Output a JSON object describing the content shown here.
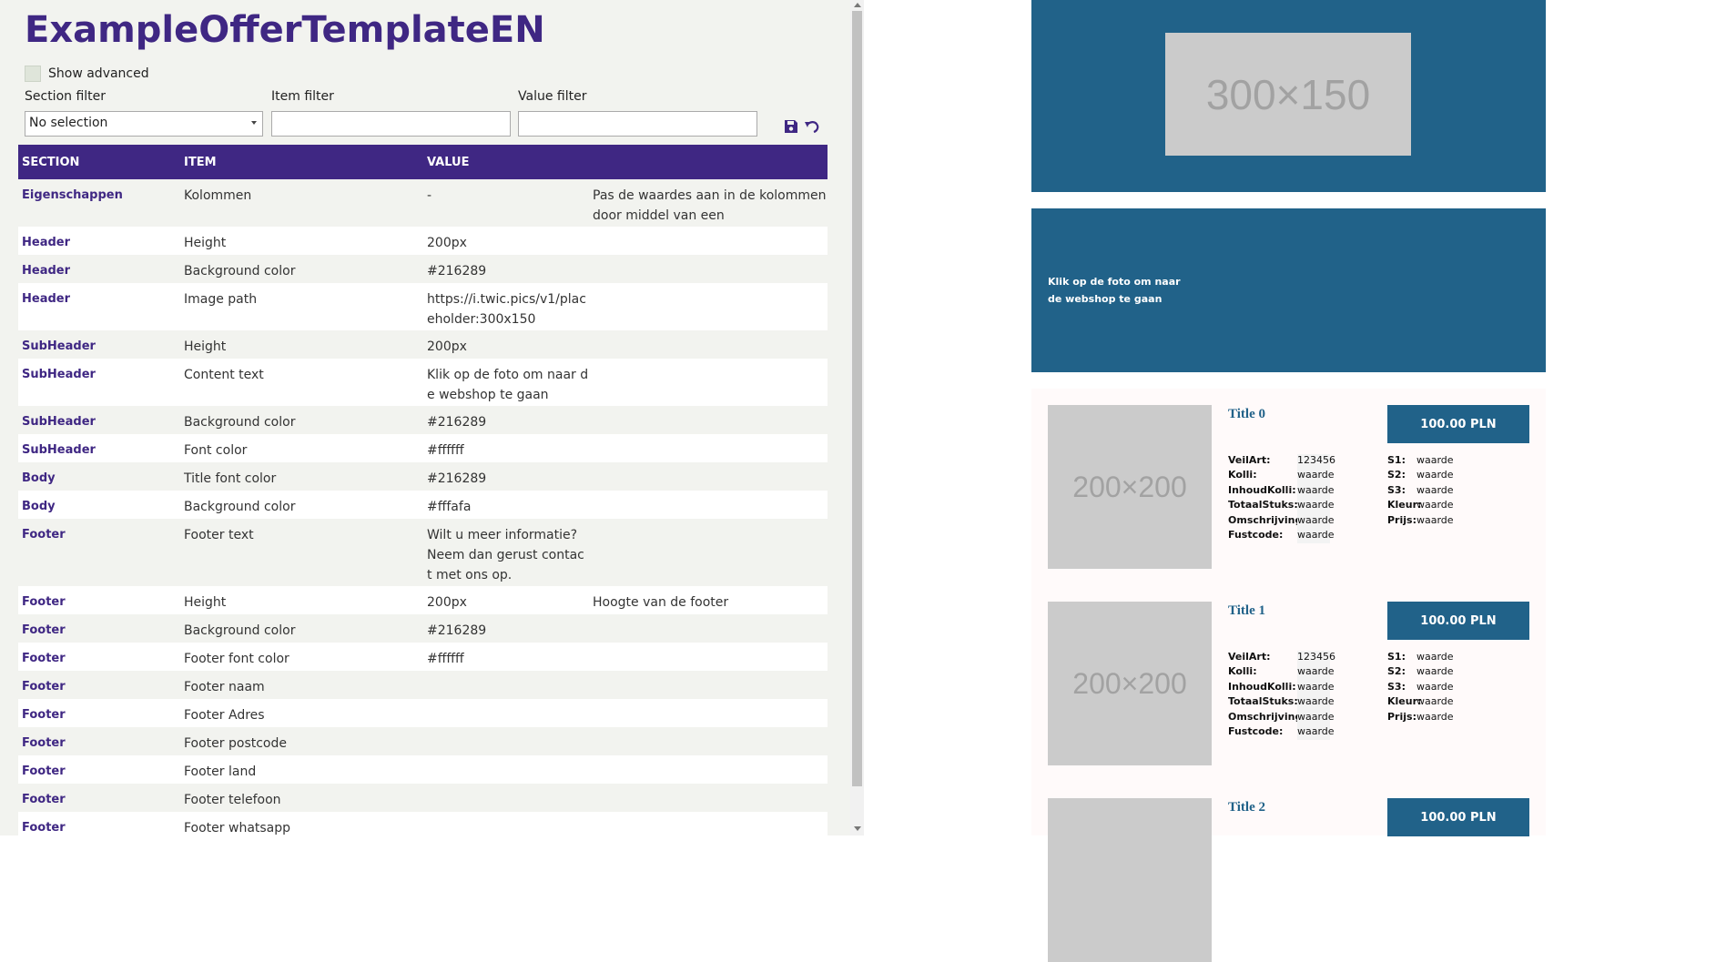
{
  "page": {
    "title": "ExampleOfferTemplateEN",
    "show_advanced_label": "Show advanced"
  },
  "filters": {
    "section_label": "Section filter",
    "section_value": "No selection",
    "item_label": "Item filter",
    "item_value": "",
    "value_label": "Value filter",
    "value_value": ""
  },
  "toolbar": {
    "save_icon": "save-icon",
    "undo_icon": "undo-icon"
  },
  "table": {
    "headers": [
      "SECTION",
      "ITEM",
      "VALUE",
      ""
    ],
    "rows": [
      {
        "section": "Eigenschappen",
        "item": "Kolommen",
        "value": "-",
        "desc": "Pas de waardes aan in de kolommen door middel van een webshopsetting"
      },
      {
        "section": "Header",
        "item": "Height",
        "value": "200px",
        "desc": ""
      },
      {
        "section": "Header",
        "item": "Background color",
        "value": "#216289",
        "desc": ""
      },
      {
        "section": "Header",
        "item": "Image path",
        "value": "https://i.twic.pics/v1/placeholder:300x150",
        "desc": ""
      },
      {
        "section": "SubHeader",
        "item": "Height",
        "value": "200px",
        "desc": ""
      },
      {
        "section": "SubHeader",
        "item": "Content text",
        "value": "Klik op de foto om naar de webshop te gaan",
        "desc": ""
      },
      {
        "section": "SubHeader",
        "item": "Background color",
        "value": "#216289",
        "desc": ""
      },
      {
        "section": "SubHeader",
        "item": "Font color",
        "value": "#ffffff",
        "desc": ""
      },
      {
        "section": "Body",
        "item": "Title font color",
        "value": "#216289",
        "desc": ""
      },
      {
        "section": "Body",
        "item": "Background color",
        "value": "#fffafa",
        "desc": ""
      },
      {
        "section": "Footer",
        "item": "Footer text",
        "value": "Wilt u meer informatie? Neem dan gerust contact met ons op.",
        "desc": ""
      },
      {
        "section": "Footer",
        "item": "Height",
        "value": "200px",
        "desc": "Hoogte van de footer"
      },
      {
        "section": "Footer",
        "item": "Background color",
        "value": "#216289",
        "desc": ""
      },
      {
        "section": "Footer",
        "item": "Footer font color",
        "value": "#ffffff",
        "desc": ""
      },
      {
        "section": "Footer",
        "item": "Footer naam",
        "value": "",
        "desc": ""
      },
      {
        "section": "Footer",
        "item": "Footer Adres",
        "value": "",
        "desc": ""
      },
      {
        "section": "Footer",
        "item": "Footer postcode",
        "value": "",
        "desc": ""
      },
      {
        "section": "Footer",
        "item": "Footer land",
        "value": "",
        "desc": ""
      },
      {
        "section": "Footer",
        "item": "Footer telefoon",
        "value": "",
        "desc": ""
      },
      {
        "section": "Footer",
        "item": "Footer whatsapp",
        "value": "",
        "desc": ""
      }
    ]
  },
  "preview": {
    "header_placeholder": "300×150",
    "subheader_text": "Klik op de foto om naar de webshop te gaan",
    "products": [
      {
        "title": "Title 0",
        "image": "200×200",
        "price": "100.00 PLN",
        "specs_a": [
          [
            "VeilArt:",
            "123456"
          ],
          [
            "Kolli:",
            "waarde"
          ],
          [
            "InhoudKolli:",
            "waarde"
          ],
          [
            "TotaalStuks:",
            "waarde"
          ],
          [
            "Omschrijving:",
            "waarde"
          ],
          [
            "Fustcode:",
            "waarde"
          ]
        ],
        "specs_b": [
          [
            "S1:",
            "waarde"
          ],
          [
            "S2:",
            "waarde"
          ],
          [
            "S3:",
            "waarde"
          ],
          [
            "Kleur:",
            "waarde"
          ],
          [
            "Prijs:",
            "waarde"
          ]
        ]
      },
      {
        "title": "Title 1",
        "image": "200×200",
        "price": "100.00 PLN",
        "specs_a": [
          [
            "VeilArt:",
            "123456"
          ],
          [
            "Kolli:",
            "waarde"
          ],
          [
            "InhoudKolli:",
            "waarde"
          ],
          [
            "TotaalStuks:",
            "waarde"
          ],
          [
            "Omschrijving:",
            "waarde"
          ],
          [
            "Fustcode:",
            "waarde"
          ]
        ],
        "specs_b": [
          [
            "S1:",
            "waarde"
          ],
          [
            "S2:",
            "waarde"
          ],
          [
            "S3:",
            "waarde"
          ],
          [
            "Kleur:",
            "waarde"
          ],
          [
            "Prijs:",
            "waarde"
          ]
        ]
      },
      {
        "title": "Title 2",
        "image": "",
        "price": "100.00 PLN",
        "specs_a": [],
        "specs_b": []
      }
    ]
  },
  "colors": {
    "accent": "#3f2783",
    "preview_blue": "#216289",
    "body_bg": "#fffafa"
  }
}
